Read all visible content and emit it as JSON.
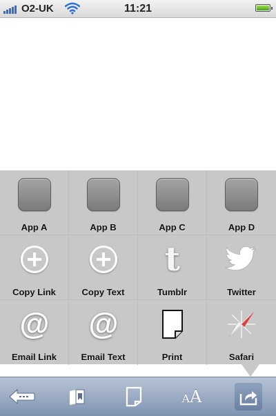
{
  "status_bar": {
    "carrier": "O2-UK",
    "time": "11:21"
  },
  "share_sheet": {
    "items": [
      {
        "label": "App A",
        "icon": "app-placeholder-icon"
      },
      {
        "label": "App B",
        "icon": "app-placeholder-icon"
      },
      {
        "label": "App C",
        "icon": "app-placeholder-icon"
      },
      {
        "label": "App D",
        "icon": "app-placeholder-icon"
      },
      {
        "label": "Copy Link",
        "icon": "plus-circle-icon"
      },
      {
        "label": "Copy Text",
        "icon": "plus-circle-icon"
      },
      {
        "label": "Tumblr",
        "icon": "tumblr-icon"
      },
      {
        "label": "Twitter",
        "icon": "twitter-bird-icon"
      },
      {
        "label": "Email Link",
        "icon": "at-sign-icon"
      },
      {
        "label": "Email Text",
        "icon": "at-sign-icon"
      },
      {
        "label": "Print",
        "icon": "page-icon"
      },
      {
        "label": "Safari",
        "icon": "compass-icon"
      }
    ]
  },
  "toolbar": {
    "buttons": [
      {
        "name": "back",
        "icon": "back-arrow-icon"
      },
      {
        "name": "bookmarks",
        "icon": "bookmark-folder-icon"
      },
      {
        "name": "page",
        "icon": "page-icon"
      },
      {
        "name": "font-size",
        "icon": "text-size-icon",
        "glyph_small": "A",
        "glyph_large": "A"
      },
      {
        "name": "share",
        "icon": "share-icon"
      }
    ]
  },
  "colors": {
    "sheet_bg": "#c8c8c8",
    "toolbar_top": "#b8c4d6",
    "toolbar_bottom": "#7f93b1",
    "signal": "#2a6fd1",
    "battery": "#6cc33a"
  }
}
